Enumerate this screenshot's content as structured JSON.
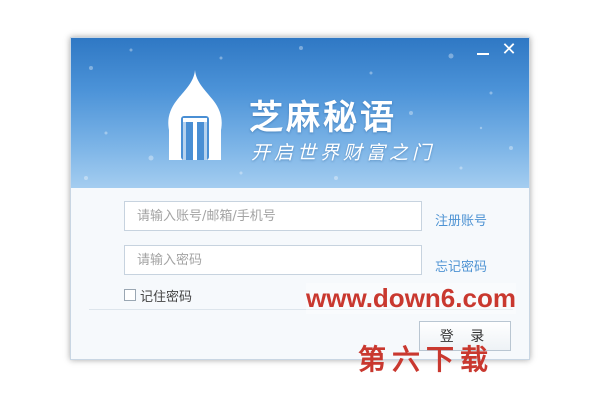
{
  "window": {
    "minimize_label": "—",
    "close_label": "✕"
  },
  "brand": {
    "name": "芝麻秘语",
    "slogan": "开启世界财富之门",
    "logo_icon": "dome-door-icon"
  },
  "login_form": {
    "account_placeholder": "请输入账号/邮箱/手机号",
    "account_value": "",
    "password_placeholder": "请输入密码",
    "password_value": "",
    "register_label": "注册账号",
    "forgot_label": "忘记密码",
    "remember_label": "记住密码",
    "remember_checked": false,
    "login_label": "登 录"
  },
  "watermark": {
    "url": "www.down6.com",
    "text": "第六下载"
  },
  "colors": {
    "banner_top": "#2f78c4",
    "banner_bottom": "#a4cdf0",
    "link": "#4e93d3",
    "watermark": "#c9382f"
  }
}
